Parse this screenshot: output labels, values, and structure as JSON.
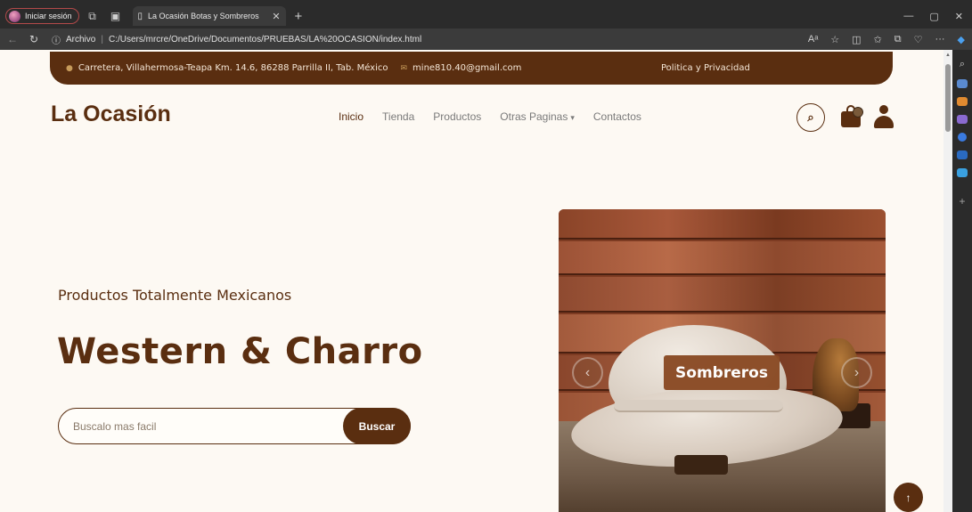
{
  "browser": {
    "profile_label": "Iniciar sesión",
    "tab_title": "La Ocasión Botas y Sombreros",
    "tab_close": "✕",
    "new_tab": "+",
    "address_prefix": "Archivo",
    "address_url": "C:/Users/mrcre/OneDrive/Documentos/PRUEBAS/LA%20OCASION/index.html",
    "window_controls": [
      "—",
      "▢",
      "✕"
    ]
  },
  "topbar": {
    "address": "Carretera, Villahermosa-Teapa Km. 14.6, 86288 Parrilla II, Tab. México",
    "email": "mine810.40@gmail.com",
    "policy": "Politica y Privacidad"
  },
  "header": {
    "logo": "La Ocasión",
    "nav": [
      {
        "label": "Inicio",
        "active": true
      },
      {
        "label": "Tienda"
      },
      {
        "label": "Productos"
      },
      {
        "label": "Otras Paginas"
      },
      {
        "label": "Contactos"
      }
    ]
  },
  "hero": {
    "subtitle": "Productos Totalmente Mexicanos",
    "title": "Western & Charro",
    "search_placeholder": "Buscalo mas facil",
    "search_button": "Buscar"
  },
  "carousel": {
    "slide_label": "Sombreros"
  },
  "colors": {
    "brand": "#5a2e10",
    "background": "#fdf9f3",
    "slide_label": "#8a4a24"
  }
}
